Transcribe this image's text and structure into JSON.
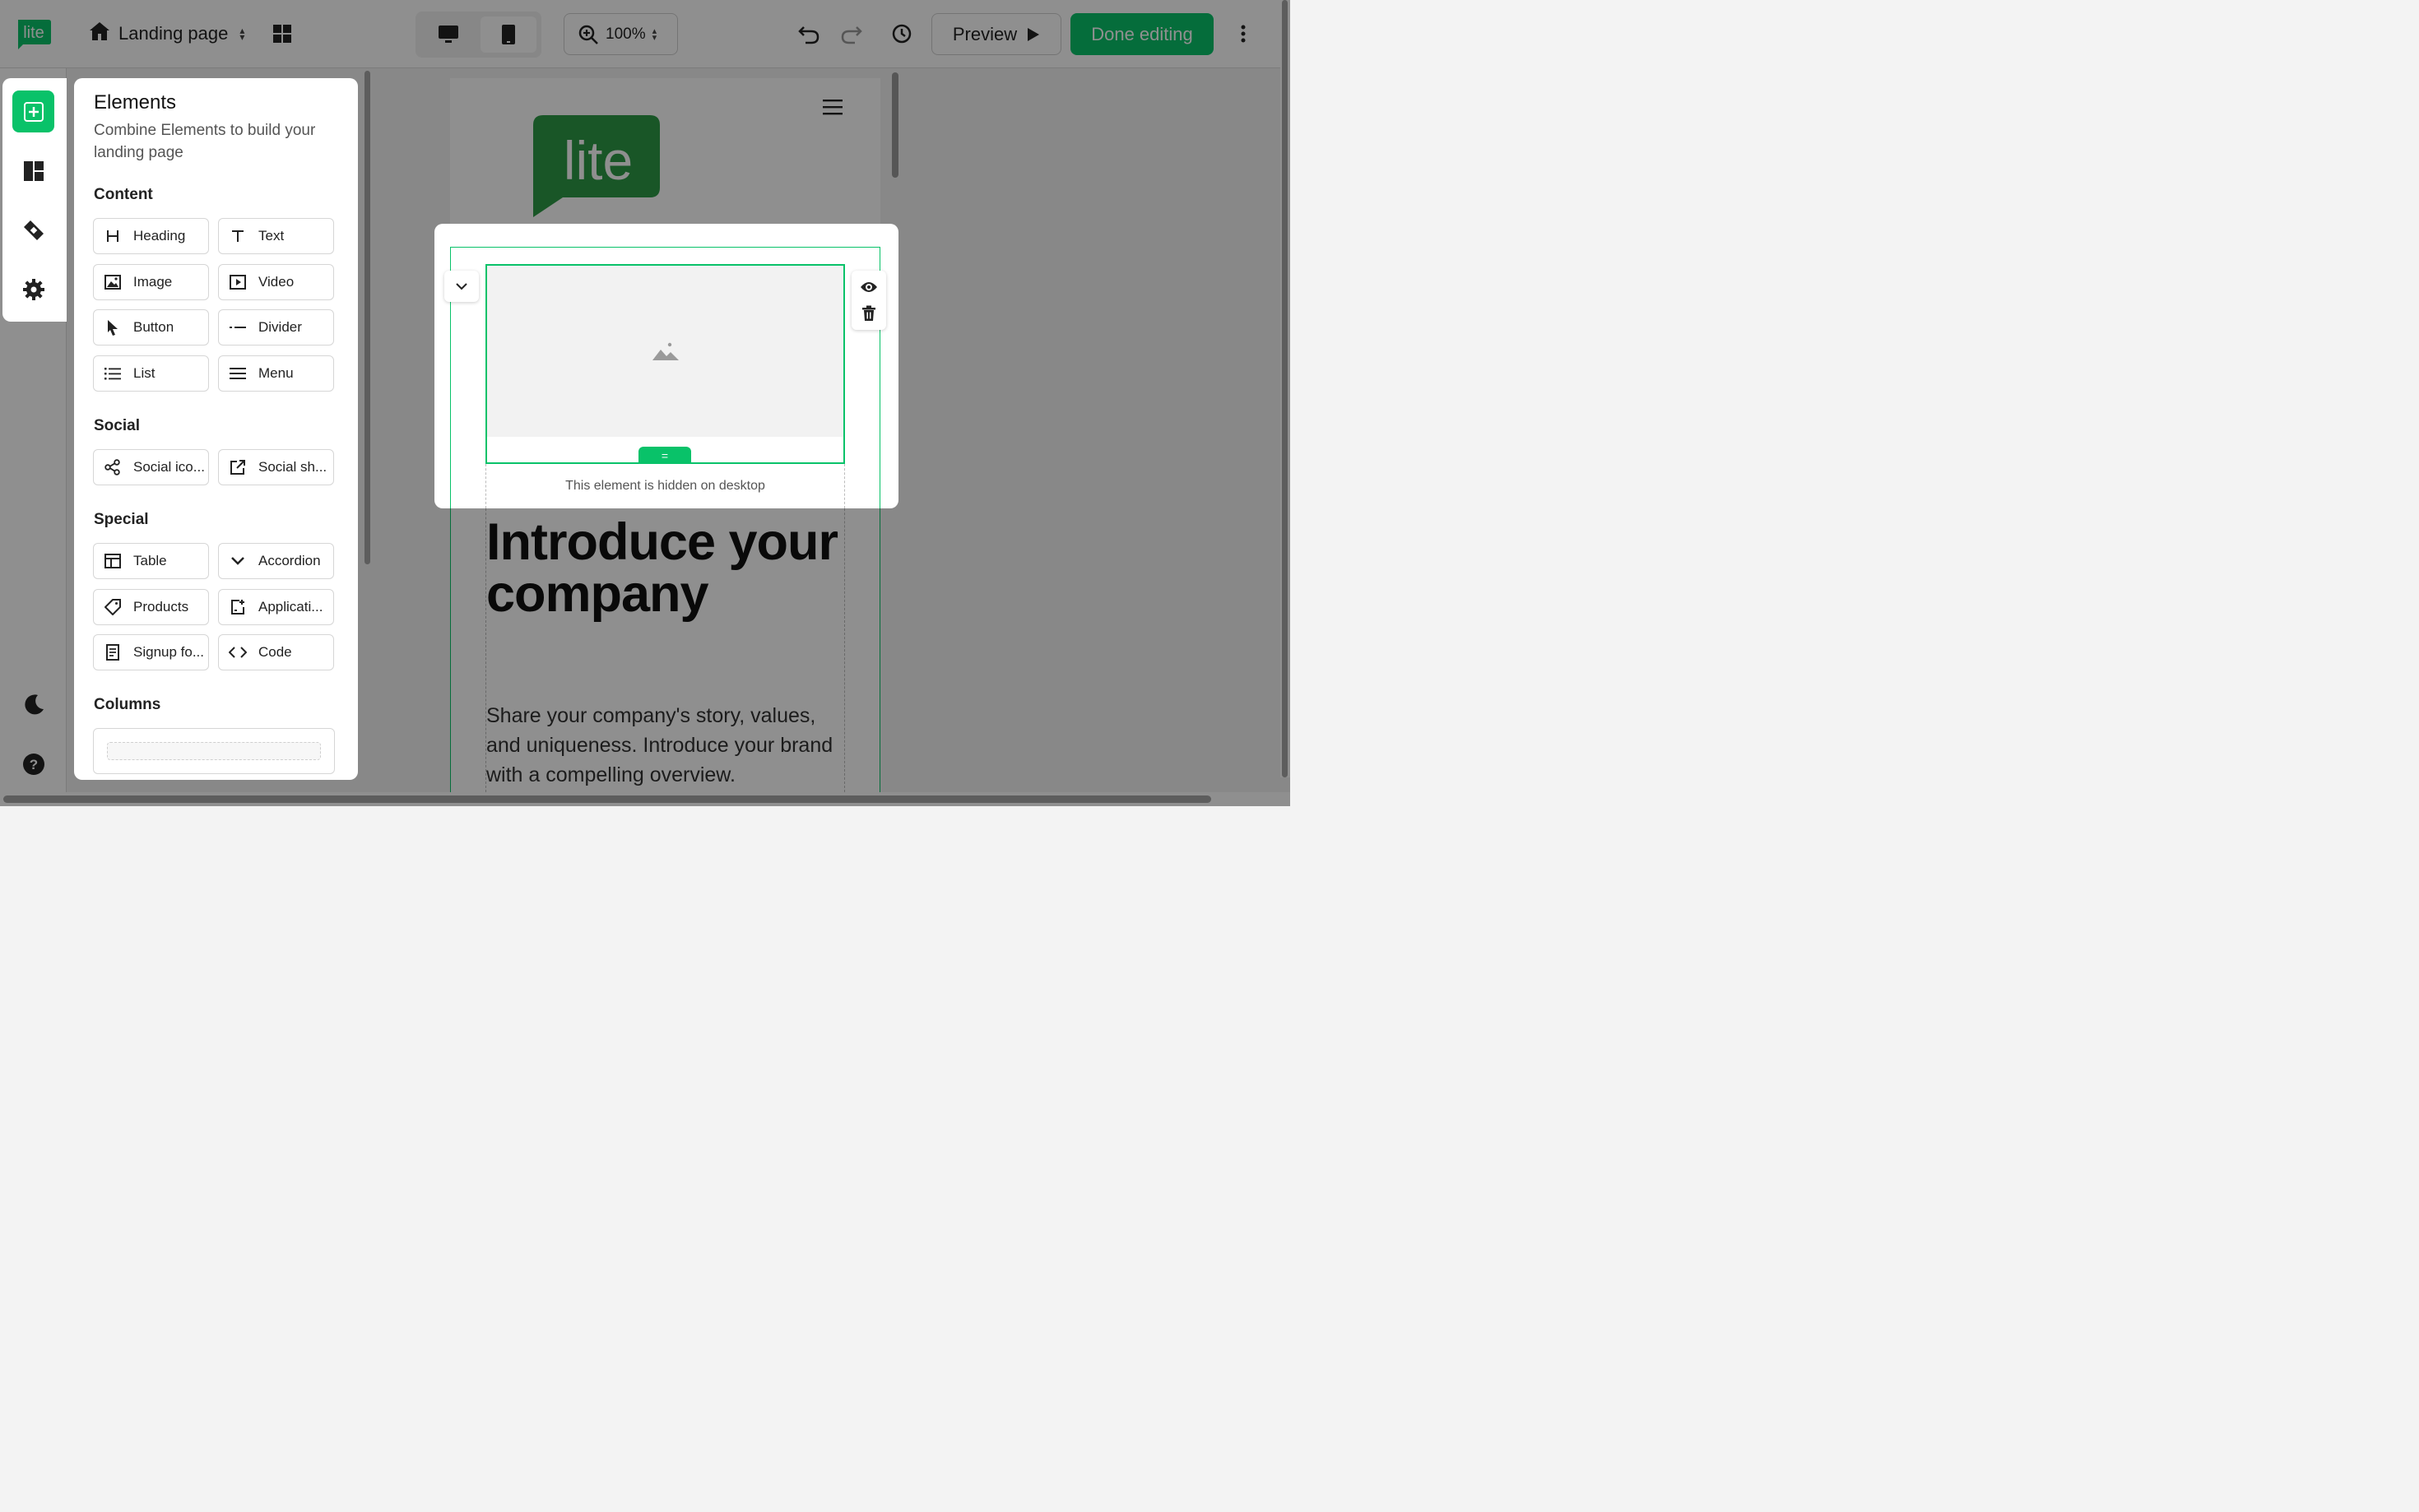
{
  "header": {
    "page_name": "Landing page",
    "zoom": "100%",
    "preview_label": "Preview",
    "done_label": "Done editing",
    "logo_text": "lite"
  },
  "panel": {
    "title": "Elements",
    "subtitle": "Combine Elements to build your landing page",
    "sections": {
      "content": "Content",
      "social": "Social",
      "special": "Special",
      "columns": "Columns"
    },
    "content_items": [
      "Heading",
      "Text",
      "Image",
      "Video",
      "Button",
      "Divider",
      "List",
      "Menu"
    ],
    "social_items": [
      "Social ico...",
      "Social sh..."
    ],
    "special_items": [
      "Table",
      "Accordion",
      "Products",
      "Applicati...",
      "Signup fo...",
      "Code"
    ]
  },
  "canvas": {
    "logo_text": "lite",
    "hidden_note": "This element is hidden on desktop",
    "hero_title": "Introduce your company",
    "hero_text": "Share your company's story, values, and uniqueness. Introduce your brand with a compelling overview.",
    "drag_handle": "="
  },
  "colors": {
    "accent": "#09c269",
    "brand_dark": "#1f8a3c"
  }
}
